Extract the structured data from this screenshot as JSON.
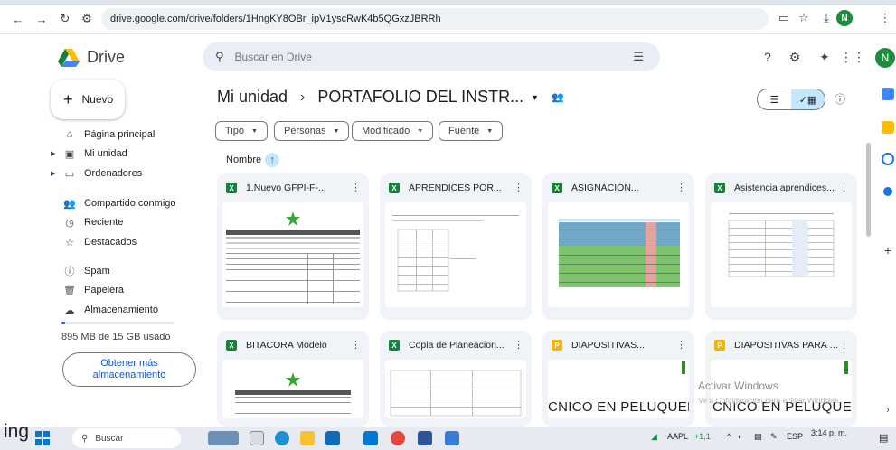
{
  "browser": {
    "url": "drive.google.com/drive/folders/1HngKY8OBr_ipV1yscRwK4b5QGxzJBRRh",
    "profile_initial": "N"
  },
  "header": {
    "app_name": "Drive",
    "search_placeholder": "Buscar en Drive",
    "avatar_initial": "N"
  },
  "sidebar": {
    "new_label": "Nuevo",
    "items": [
      {
        "label": "Página principal",
        "icon": "home-icon"
      },
      {
        "label": "Mi unidad",
        "icon": "my-drive-icon"
      },
      {
        "label": "Ordenadores",
        "icon": "computer-icon"
      },
      {
        "label": "Compartido conmigo",
        "icon": "shared-icon"
      },
      {
        "label": "Reciente",
        "icon": "clock-icon"
      },
      {
        "label": "Destacados",
        "icon": "star-icon"
      },
      {
        "label": "Spam",
        "icon": "spam-icon"
      },
      {
        "label": "Papelera",
        "icon": "trash-icon"
      },
      {
        "label": "Almacenamiento",
        "icon": "cloud-icon"
      }
    ],
    "storage_used_fraction": 0.03,
    "storage_text": "895 MB de 15 GB usado",
    "storage_button": "Obtener más almacenamiento"
  },
  "main": {
    "breadcrumb_root": "Mi unidad",
    "breadcrumb_sep": "›",
    "breadcrumb_current": "PORTAFOLIO DEL INSTR...",
    "filters": [
      "Tipo",
      "Personas",
      "Modificado",
      "Fuente"
    ],
    "sort_label": "Nombre",
    "files": [
      {
        "name": "1.Nuevo GFPI-F-...",
        "type": "sheet",
        "icon_letter": "X"
      },
      {
        "name": "APRENDICES POR...",
        "type": "sheet",
        "icon_letter": "X"
      },
      {
        "name": "ASIGNACIÓN...",
        "type": "sheet",
        "icon_letter": "X"
      },
      {
        "name": "Asistencia aprendices...",
        "type": "sheet",
        "icon_letter": "X"
      },
      {
        "name": "BITACORA Modelo",
        "type": "sheet",
        "icon_letter": "X"
      },
      {
        "name": "Copia de Planeacion...",
        "type": "sheet",
        "icon_letter": "X"
      },
      {
        "name": "DIAPOSITIVAS...",
        "type": "slides",
        "icon_letter": "P"
      },
      {
        "name": "DIAPOSITIVAS PARA L...",
        "type": "slides",
        "icon_letter": "P"
      }
    ],
    "thumb_text_peluqueria_1": "CNICO EN PELUQUERÍA",
    "thumb_text_peluqueria_2": "CNICO EN PELUQUERÍA"
  },
  "watermark": {
    "title": "Activar Windows",
    "subtitle": "Ve a Configuración para activar Windows."
  },
  "taskbar": {
    "left_text": "ing",
    "search_label": "Buscar",
    "stock": "AAPL",
    "stock_change": "+1,1",
    "language": "ESP",
    "time": "3:14 p. m."
  },
  "colors": {
    "accent": "#0b57d0",
    "sheet": "#188038",
    "slides": "#f4b400",
    "card_bg": "#f0f4f9",
    "selected": "#c2e7ff"
  }
}
